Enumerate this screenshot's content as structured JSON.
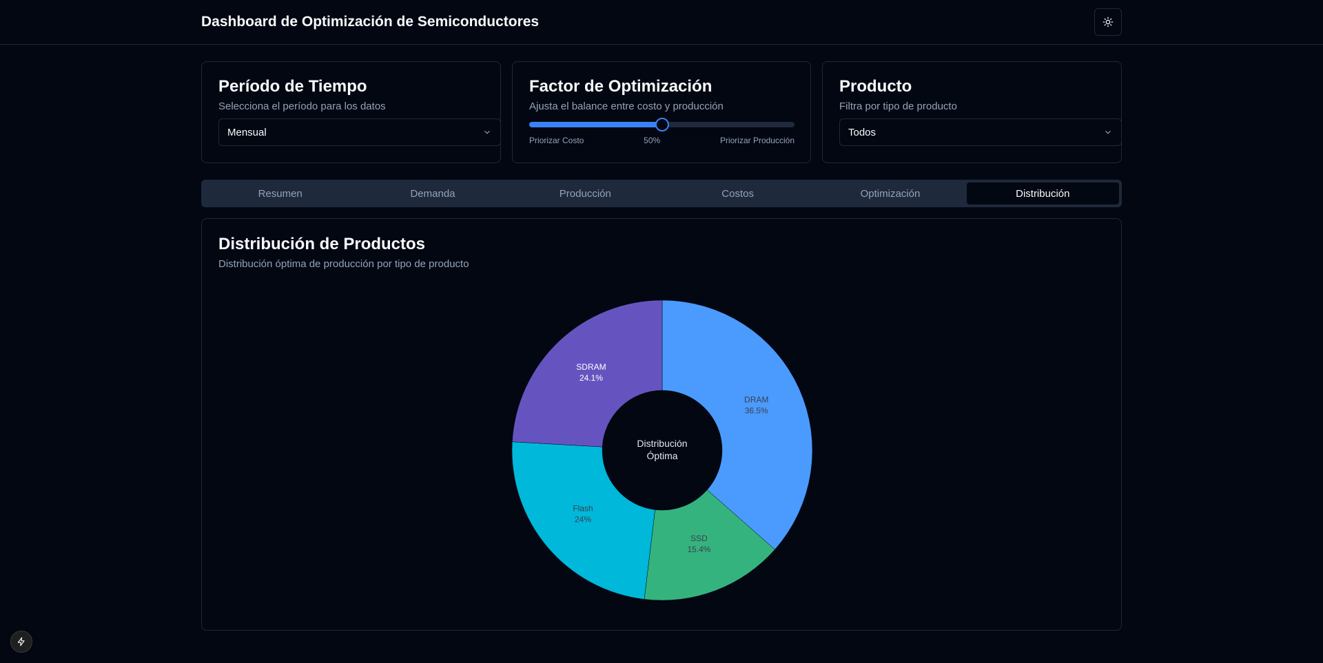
{
  "header": {
    "title": "Dashboard de Optimización de Semiconductores",
    "theme_icon": "sun-icon"
  },
  "filters": {
    "period": {
      "title": "Período de Tiempo",
      "description": "Selecciona el período para los datos",
      "value": "Mensual"
    },
    "optimization": {
      "title": "Factor de Optimización",
      "description": "Ajusta el balance entre costo y producción",
      "value": 0.5,
      "left_label": "Priorizar Costo",
      "value_label": "50%",
      "right_label": "Priorizar Producción"
    },
    "product": {
      "title": "Producto",
      "description": "Filtra por tipo de producto",
      "value": "Todos"
    }
  },
  "tabs": [
    {
      "label": "Resumen"
    },
    {
      "label": "Demanda"
    },
    {
      "label": "Producción"
    },
    {
      "label": "Costos"
    },
    {
      "label": "Optimización"
    },
    {
      "label": "Distribución",
      "active": true
    }
  ],
  "chart_card": {
    "title": "Distribución de Productos",
    "description": "Distribución óptima de producción por tipo de producto"
  },
  "chart_data": {
    "type": "pie",
    "donut": true,
    "center_label": [
      "Distribución",
      "Óptima"
    ],
    "slices": [
      {
        "name": "DRAM",
        "value": 36.5,
        "label": "36.5%",
        "color": "#4b9bff"
      },
      {
        "name": "SSD",
        "value": 15.4,
        "label": "15.4%",
        "color": "#35b37e"
      },
      {
        "name": "Flash",
        "value": 24,
        "label": "24%",
        "color": "#00b8d9"
      },
      {
        "name": "SDRAM",
        "value": 24.1,
        "label": "24.1%",
        "color": "#6554c0"
      }
    ]
  },
  "colors": {
    "background": "#030712",
    "border": "#1e293b",
    "accent": "#3b82f6",
    "muted_text": "#94a3b8"
  }
}
